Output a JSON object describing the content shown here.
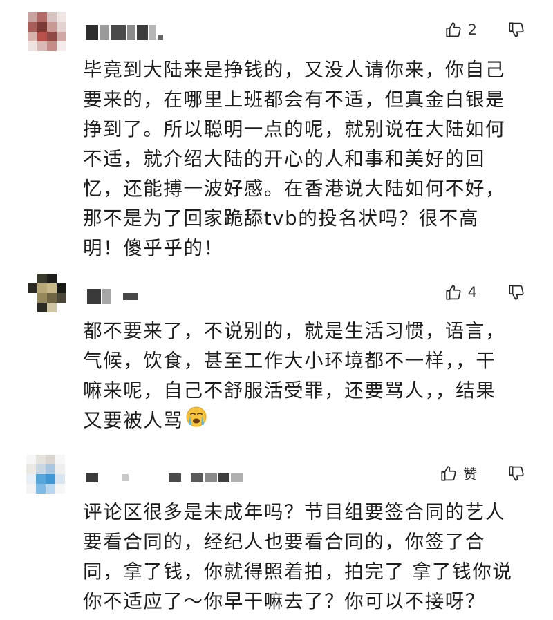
{
  "comments": [
    {
      "like_count": "2",
      "lines": [
        "毕竟到大陆来是挣钱的，又没人请你来，你自己",
        "要来的，在哪里上班都会有不适，但真金白银是",
        "挣到了。所以聪明一点的呢，就别说在大陆如何",
        "不适，就介绍大陆的开心的人和事和美好的回",
        "忆，还能搏一波好感。在香港说大陆如何不好，",
        "那不是为了回家跪舔tvb的投名状吗？很不高",
        "明！傻乎乎的！"
      ]
    },
    {
      "like_count": "4",
      "lines": [
        "都不要来了，不说别的，就是生活习惯，语言，",
        "气候，饮食，甚至工作大小环境都不一样，，干",
        "嘛来呢，自己不舒服活受罪，还要骂人，，结果",
        "又要被人骂"
      ],
      "emoji": "crying-face-icon"
    },
    {
      "like_count": "赞",
      "lines": [
        "评论区很多是未成年吗？节目组要签合同的艺人",
        "要看合同的，经纪人也要看合同的，你签了合",
        "同，拿了钱，你就得照着拍，拍完了 拿了钱你说",
        "你不适应了～你早干嘛去了？你可以不接呀？"
      ]
    }
  ],
  "colors": {
    "text": "#1d1d1d",
    "icon": "#2a2a2a"
  }
}
